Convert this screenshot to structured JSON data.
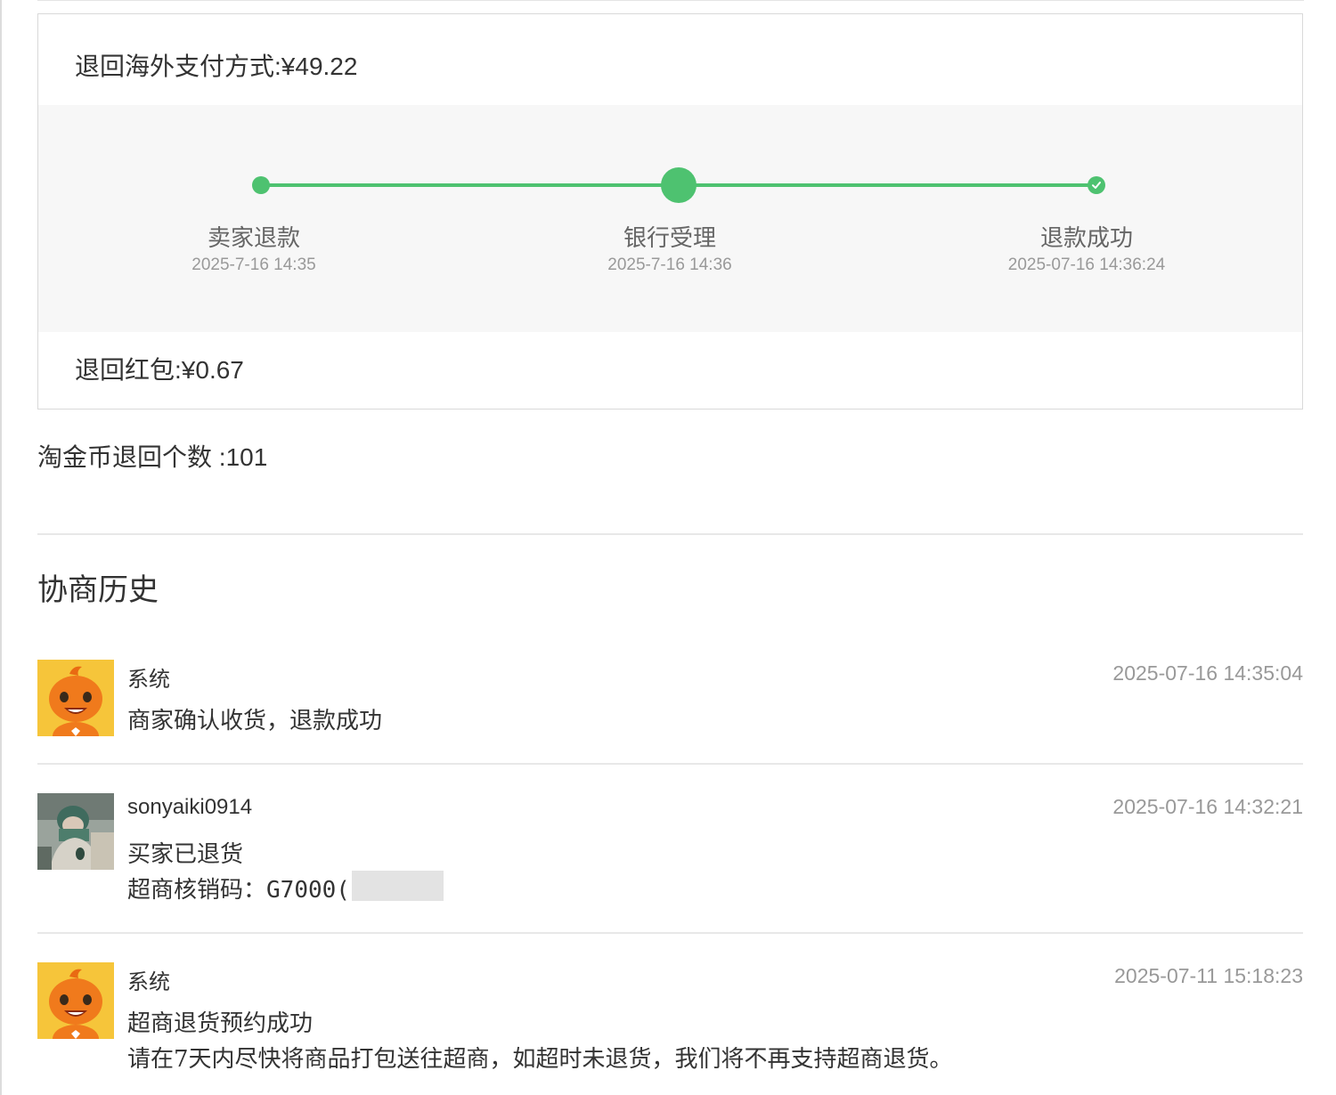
{
  "refund": {
    "overseas_label": "退回海外支付方式",
    "overseas_amount": "¥49.22",
    "redpacket_label": "退回红包",
    "redpacket_amount": "¥0.67",
    "steps": [
      {
        "name": "卖家退款",
        "time": "2025-7-16 14:35"
      },
      {
        "name": "银行受理",
        "time": "2025-7-16 14:36"
      },
      {
        "name": "退款成功",
        "time": "2025-07-16 14:36:24"
      }
    ],
    "completed_steps": 3,
    "accent_color": "#4ec270"
  },
  "coins": {
    "label": "淘金币退回个数",
    "value": "101"
  },
  "history": {
    "title": "协商历史",
    "entries": [
      {
        "author": "系统",
        "time": "2025-07-16 14:35:04",
        "lines": [
          "商家确认收货，退款成功"
        ]
      },
      {
        "author": "sonyaiki0914",
        "time": "2025-07-16 14:32:21",
        "lines": [
          "买家已退货"
        ],
        "code_label": "超商核销码：",
        "code_value": "G7000("
      },
      {
        "author": "系统",
        "time": "2025-07-11 15:18:23",
        "lines": [
          "超商退货预约成功",
          "请在7天内尽快将商品打包送往超商，如超时未退货，我们将不再支持超商退货。"
        ]
      }
    ]
  },
  "icons": {
    "system_avatar": "orange-mascot-icon",
    "user_avatar": "user-photo",
    "success": "check-icon"
  }
}
